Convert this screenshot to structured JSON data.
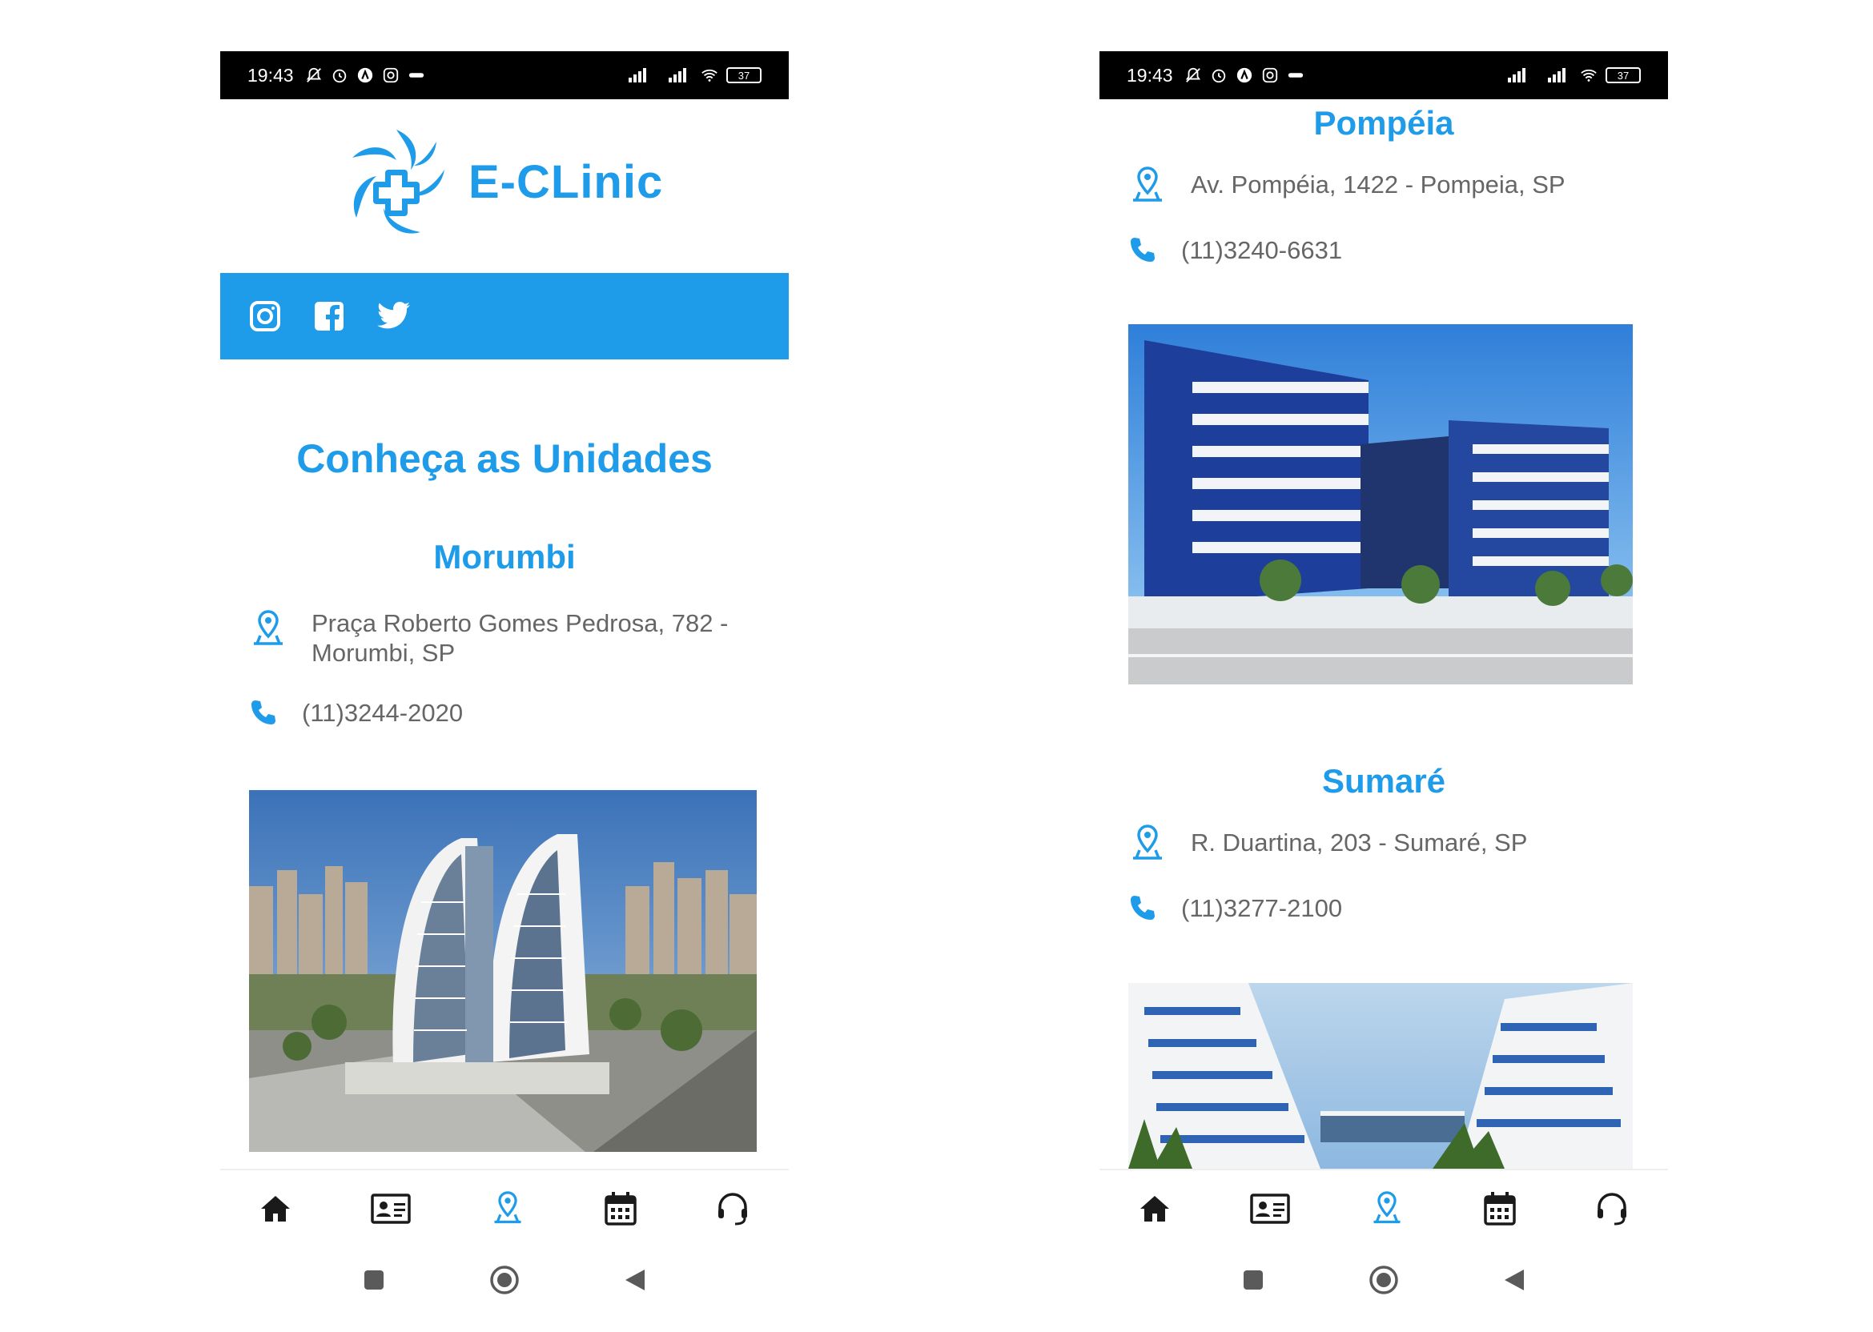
{
  "status": {
    "time": "19:43",
    "battery": "37"
  },
  "left": {
    "brand": "E-CLinic",
    "heading": "Conheça as Unidades",
    "unit": {
      "name": "Morumbi",
      "address_line1": "Praça Roberto Gomes Pedrosa, 782 -",
      "address_line2": "Morumbi, SP",
      "phone": "(11)3244-2020"
    }
  },
  "right": {
    "units": [
      {
        "name": "Pompéia",
        "address": "Av. Pompéia, 1422 - Pompeia, SP",
        "phone": "(11)3240-6631"
      },
      {
        "name": "Sumaré",
        "address": "R. Duartina, 203 - Sumaré, SP",
        "phone": "(11)3277-2100"
      }
    ]
  },
  "nav": {
    "items": [
      {
        "icon": "home-icon",
        "active": false
      },
      {
        "icon": "contact-card-icon",
        "active": false
      },
      {
        "icon": "location-pin-icon",
        "active": true
      },
      {
        "icon": "calendar-icon",
        "active": false
      },
      {
        "icon": "headset-icon",
        "active": false
      }
    ]
  },
  "colors": {
    "brand": "#1e9be9",
    "text": "#666666",
    "nav_dark": "#1a1a1a"
  }
}
